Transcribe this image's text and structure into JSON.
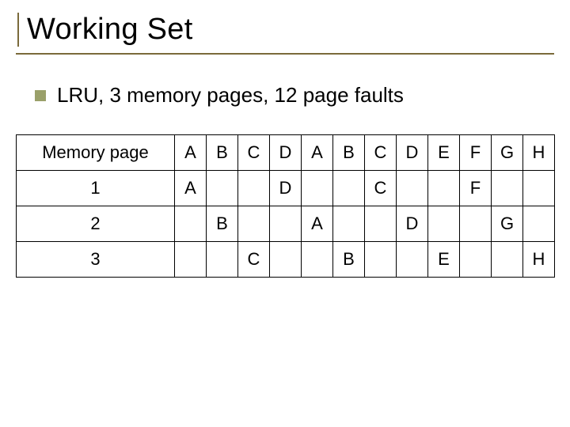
{
  "title": "Working Set",
  "bullet": "LRU, 3 memory pages, 12 page faults",
  "table": {
    "header_label": "Memory page",
    "columns": [
      "A",
      "B",
      "C",
      "D",
      "A",
      "B",
      "C",
      "D",
      "E",
      "F",
      "G",
      "H"
    ],
    "rows": [
      {
        "label": "1",
        "cells": [
          "A",
          "",
          "",
          "D",
          "",
          "",
          "C",
          "",
          "",
          "F",
          "",
          ""
        ]
      },
      {
        "label": "2",
        "cells": [
          "",
          "B",
          "",
          "",
          "A",
          "",
          "",
          "D",
          "",
          "",
          "G",
          ""
        ]
      },
      {
        "label": "3",
        "cells": [
          "",
          "",
          "C",
          "",
          "",
          "B",
          "",
          "",
          "E",
          "",
          "",
          "H"
        ]
      }
    ]
  }
}
